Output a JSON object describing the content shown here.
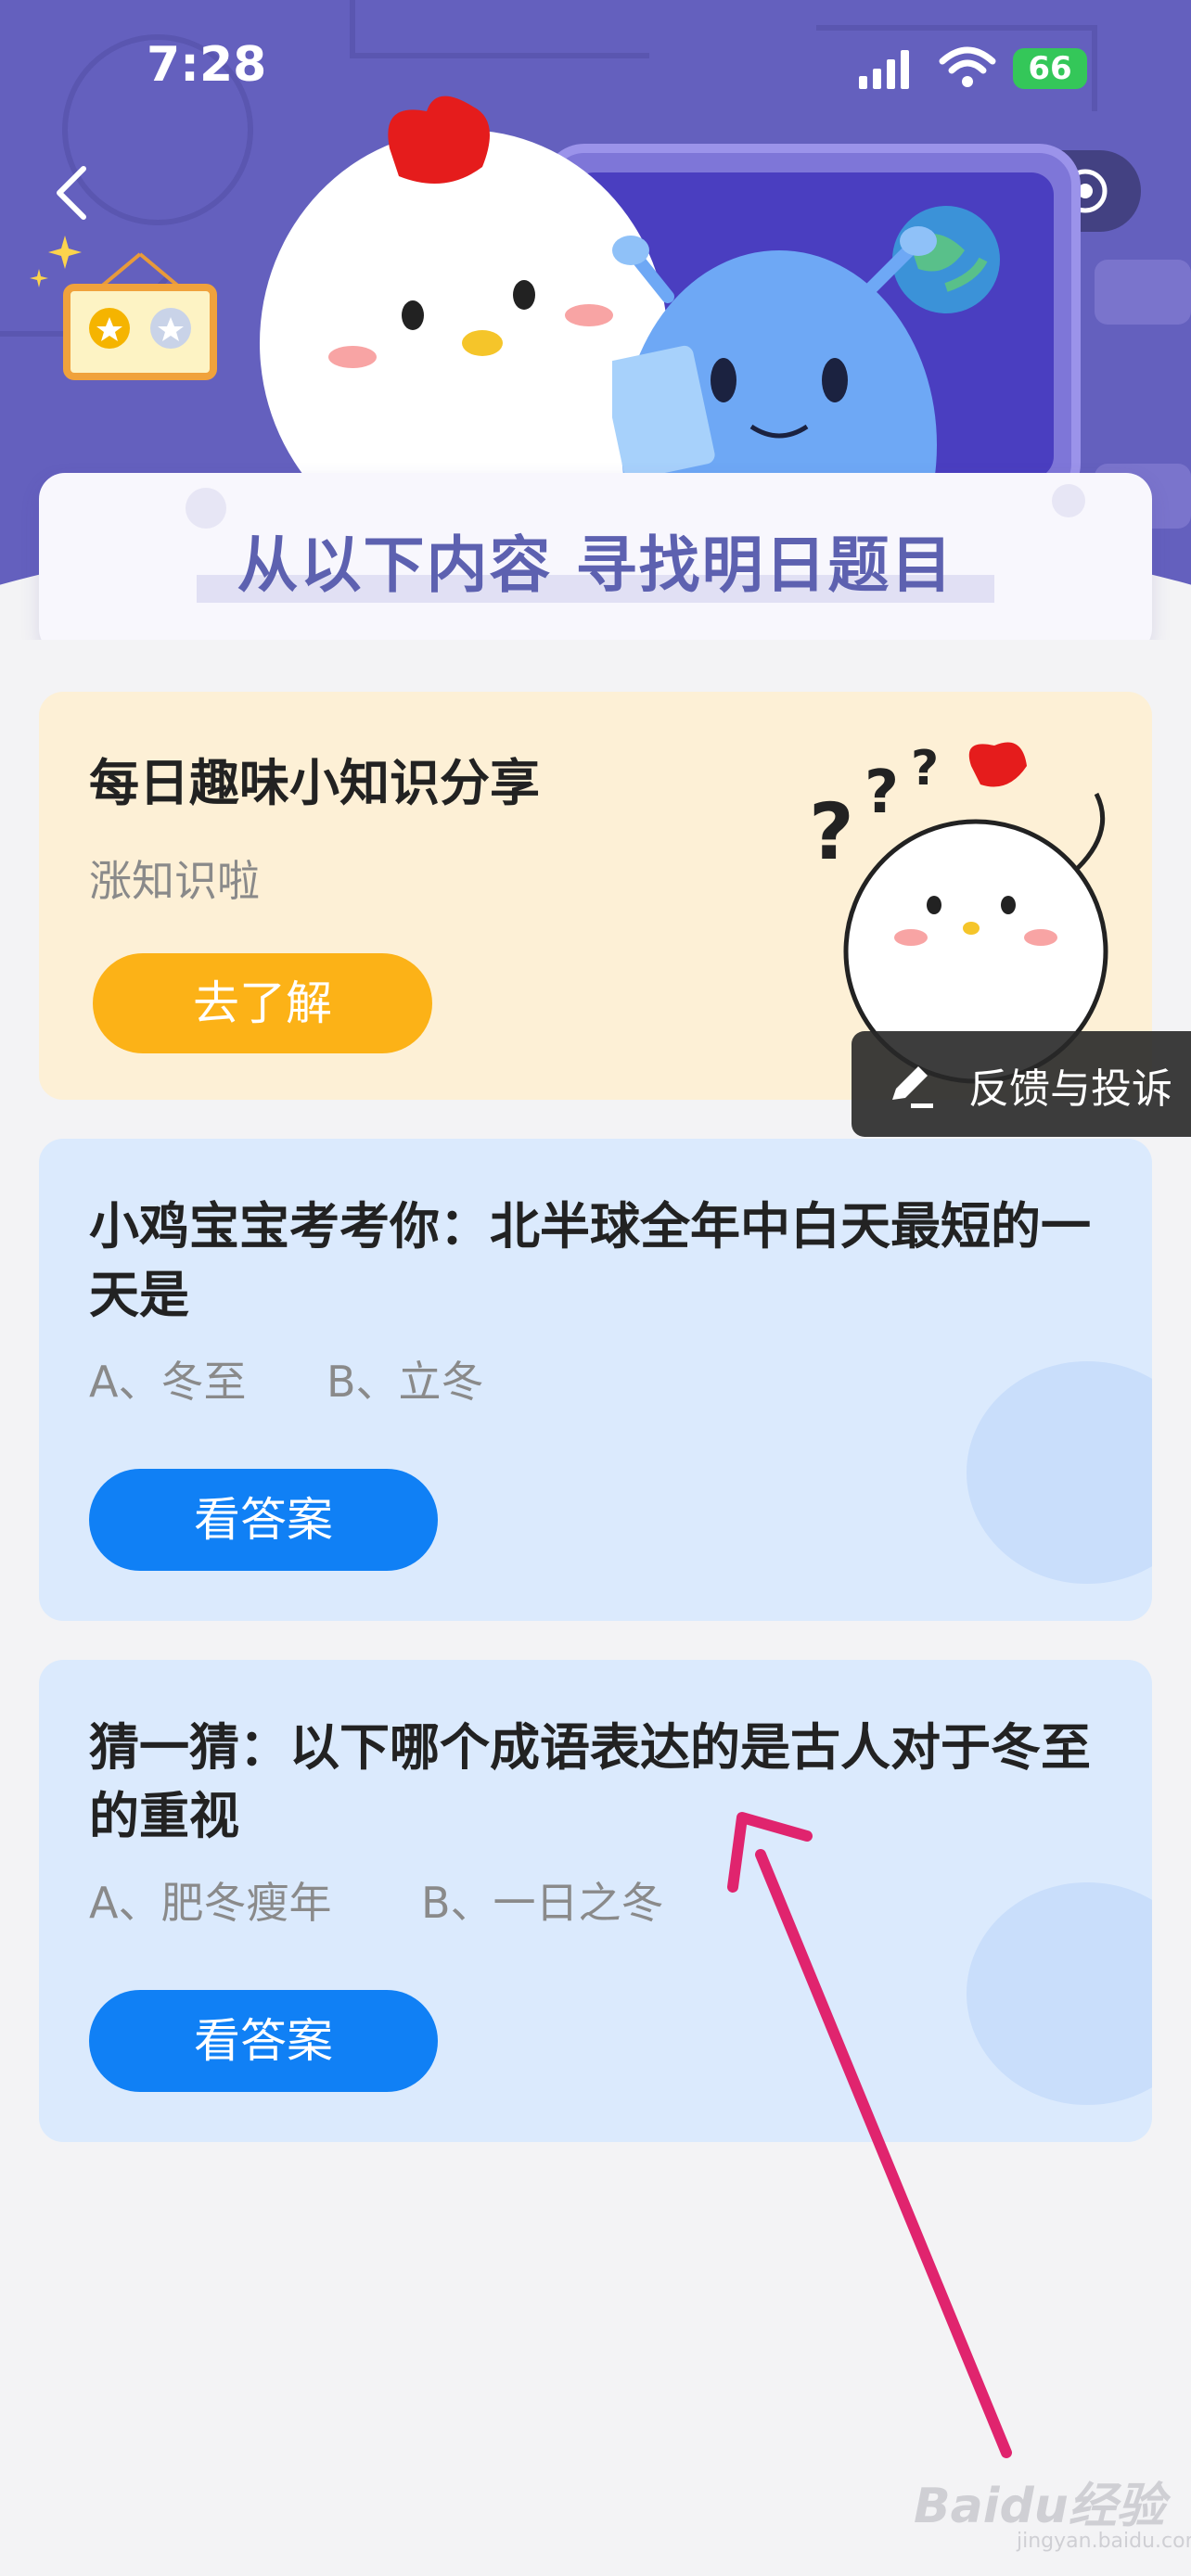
{
  "status_bar": {
    "time": "7:28",
    "battery": "66"
  },
  "banner": {
    "title": "从以下内容 寻找明日题目"
  },
  "cards": [
    {
      "title": "每日趣味小知识分享",
      "subtitle": "涨知识啦",
      "button": "去了解"
    },
    {
      "title": "小鸡宝宝考考你：北半球全年中白天最短的一天是",
      "options": [
        "A、冬至",
        "B、立冬"
      ],
      "button": "看答案"
    },
    {
      "title": "猜一猜：以下哪个成语表达的是古人对于冬至的重视",
      "options": [
        "A、肥冬瘦年",
        "B、一日之冬"
      ],
      "button": "看答案"
    }
  ],
  "feedback": {
    "label": "反馈与投诉"
  },
  "watermark": {
    "brand": "Baidu经验",
    "url": "jingyan.baidu.com"
  },
  "colors": {
    "hero_bg": "#6460be",
    "banner_text": "#5d61b0",
    "orange_button": "#fcb217",
    "blue_button": "#1080f5",
    "arrow": "#e0246e"
  }
}
